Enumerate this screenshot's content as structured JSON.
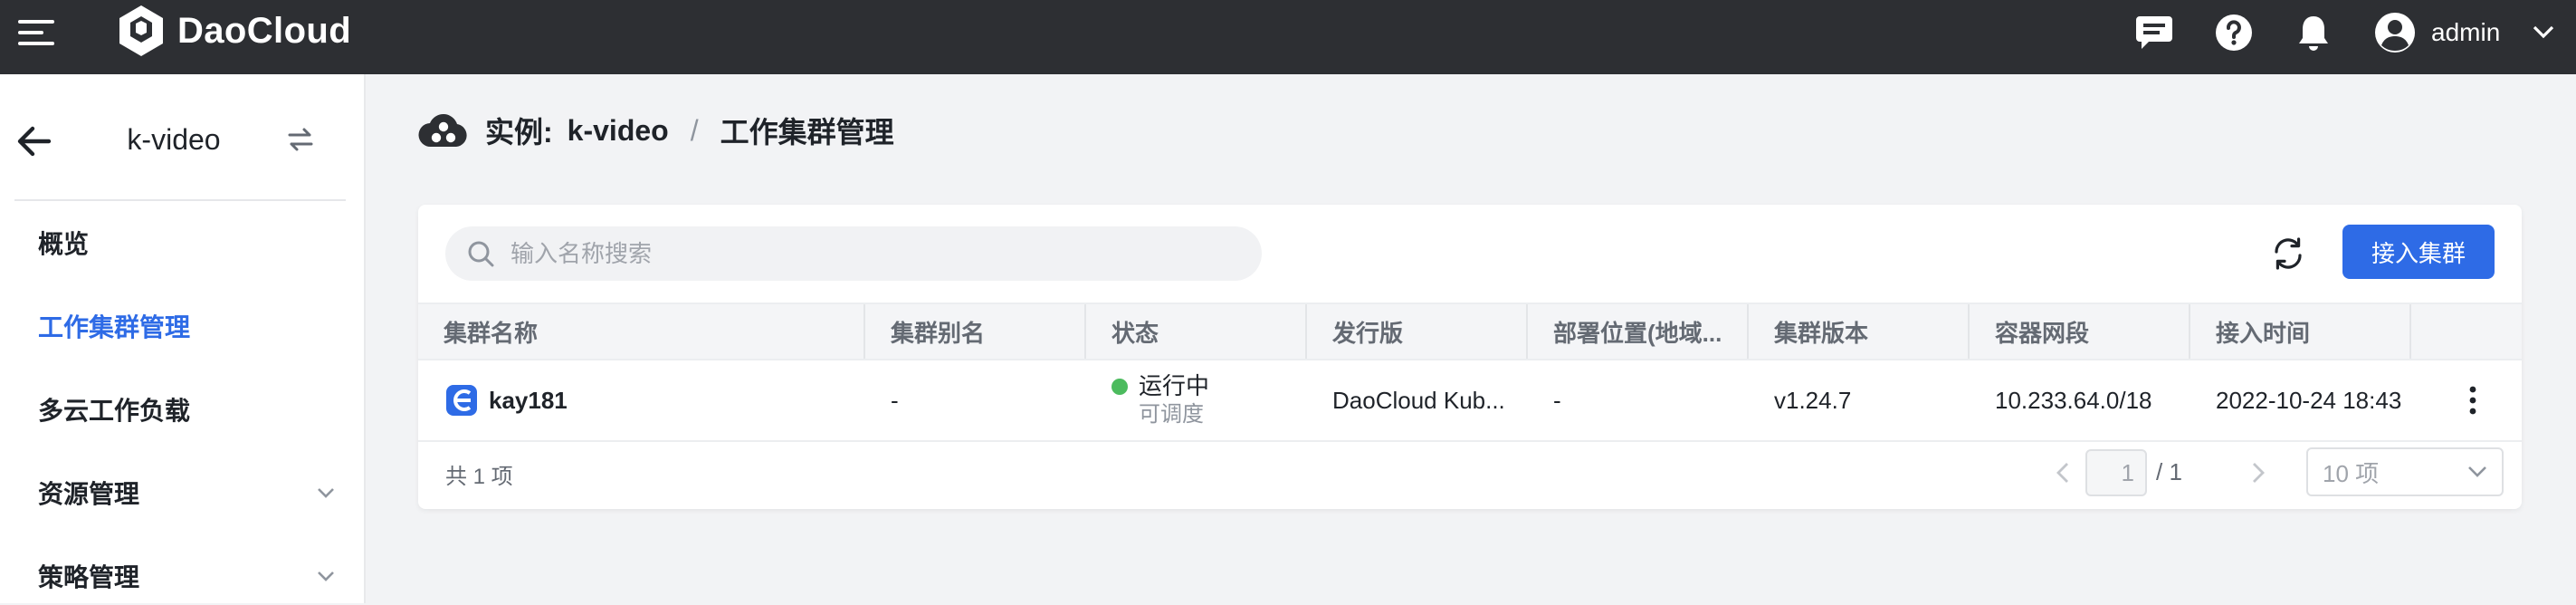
{
  "header": {
    "brand": "DaoCloud",
    "user": "admin",
    "icons": [
      "menu-icon",
      "message-icon",
      "help-icon",
      "bell-icon",
      "user-avatar-icon",
      "chevron-down-icon"
    ]
  },
  "sidebar": {
    "instance_name": "k-video",
    "items": [
      {
        "label": "概览",
        "active": false,
        "expandable": false
      },
      {
        "label": "工作集群管理",
        "active": true,
        "expandable": false
      },
      {
        "label": "多云工作负载",
        "active": false,
        "expandable": false
      },
      {
        "label": "资源管理",
        "active": false,
        "expandable": true
      },
      {
        "label": "策略管理",
        "active": false,
        "expandable": true
      }
    ]
  },
  "breadcrumb": {
    "prefix": "实例:",
    "instance": "k-video",
    "separator": "/",
    "current": "工作集群管理"
  },
  "toolbar": {
    "search_placeholder": "输入名称搜索",
    "primary_button": "接入集群"
  },
  "table": {
    "columns": [
      "集群名称",
      "集群别名",
      "状态",
      "发行版",
      "部署位置(地域...",
      "集群版本",
      "容器网段",
      "接入时间"
    ],
    "rows": [
      {
        "name": "kay181",
        "alias": "-",
        "status": "运行中",
        "status_sub": "可调度",
        "status_color": "#4cbb5e",
        "distribution": "DaoCloud Kub...",
        "location": "-",
        "version": "v1.24.7",
        "cidr": "10.233.64.0/18",
        "joined": "2022-10-24 18:43"
      }
    ]
  },
  "pagination": {
    "total_text": "共 1 项",
    "current_page": "1",
    "total_pages": "/ 1",
    "page_size": "10 项"
  },
  "colors": {
    "accent": "#2e6be6",
    "topbar": "#2d2f33",
    "status_running": "#4cbb5e"
  }
}
